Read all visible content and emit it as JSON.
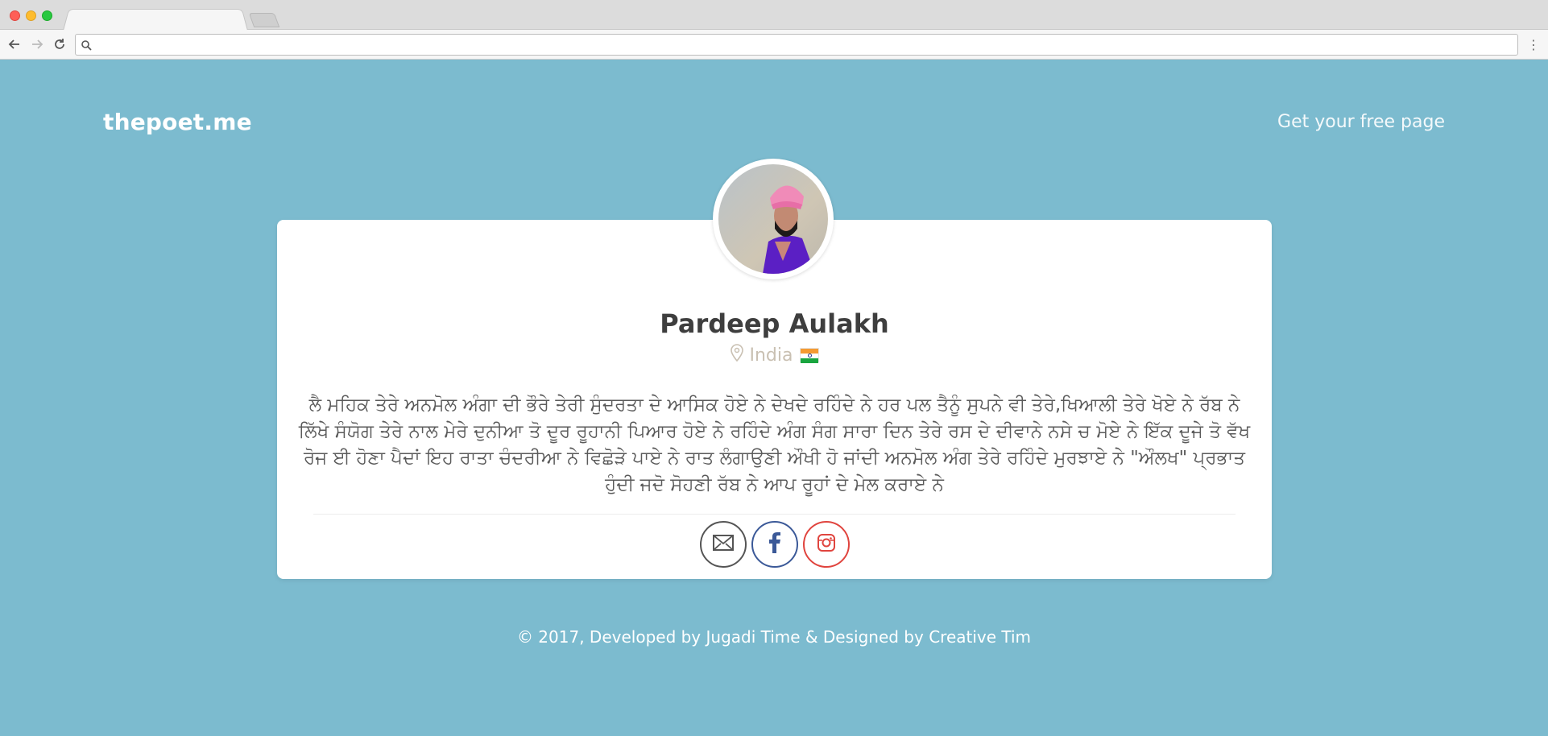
{
  "browser": {
    "address_value": "",
    "icons": {
      "back": "back-arrow-icon",
      "forward": "forward-arrow-icon",
      "reload": "reload-icon",
      "search": "search-icon",
      "menu": "menu-dots-icon"
    }
  },
  "header": {
    "brand": "thepoet.me",
    "cta": "Get your free page"
  },
  "profile": {
    "name": "Pardeep Aulakh",
    "location": "India",
    "bio": "ਲੈ ਮਹਿਕ ਤੇਰੇ ਅਨਮੋਲ ਅੰਗਾ ਦੀ ਭੌਰੇ ਤੇਰੀ ਸੁੰਦਰਤਾ ਦੇ ਆਸਿਕ ਹੋਏ ਨੇ ਦੇਖਦੇ ਰਹਿੰਦੇ ਨੇ ਹਰ ਪਲ ਤੈਨੂੰ ਸੁਪਨੇ ਵੀ ਤੇਰੇ,ਖਿਆਲੀ ਤੇਰੇ ਖੋਏ ਨੇ ਰੱਬ ਨੇ ਲਿੱਖੇ ਸੰਯੋਗ ਤੇਰੇ ਨਾਲ ਮੇਰੇ ਦੁਨੀਆ ਤੋ ਦੂਰ ਰੂਹਾਨੀ ਪਿਆਰ ਹੋਏ ਨੇ ਰਹਿੰਦੇ ਅੰਗ ਸੰਗ ਸਾਰਾ ਦਿਨ ਤੇਰੇ ਰਸ ਦੇ ਦੀਵਾਨੇ ਨਸੇ ਚ ਮੋਏ ਨੇ ਇੱਕ ਦੂਜੇ ਤੋ ਵੱਖ ਰੋਜ ਈ ਹੋਣਾ ਪੈਦਾਂ ਇਹ ਰਾਤਾ ਚੰਦਰੀਆ ਨੇ ਵਿਛੋੜੇ ਪਾਏ ਨੇ ਰਾਤ ਲੰਗਾਉਣੀ ਔਖੀ ਹੋ ਜਾਂਦੀ ਅਨਮੋਲ ਅੰਗ ਤੇਰੇ ਰਹਿੰਦੇ ਮੁਰਝਾਏ ਨੇ \"ਔਲਖ\" ਪ੍ਰਭਾਤ ਹੁੰਦੀ ਜਦੋ ਸੋਹਣੀ ਰੱਬ ਨੇ ਆਪ ਰੂਹਾਂ ਦੇ ਮੇਲ ਕਰਾਏ ਨੇ",
    "location_icon": "map-pin-icon",
    "flag": "india-flag-icon"
  },
  "social": [
    {
      "name": "email",
      "icon": "email-icon",
      "color": "#555555"
    },
    {
      "name": "facebook",
      "icon": "facebook-icon",
      "color": "#3b5998"
    },
    {
      "name": "instagram",
      "icon": "instagram-icon",
      "color": "#e0443e"
    }
  ],
  "footer": {
    "text": "© 2017, Developed by Jugadi Time & Designed by Creative Tim"
  },
  "colors": {
    "page_bg": "#7cbbcf",
    "card_bg": "#ffffff",
    "name": "#3e3e3e",
    "location": "#c9c0b2",
    "bio": "#5a5a5a"
  }
}
